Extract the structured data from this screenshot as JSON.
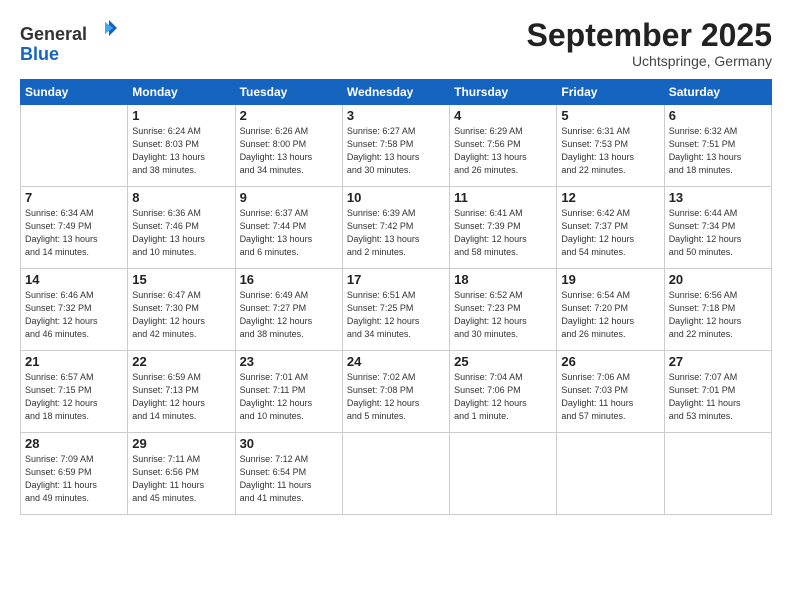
{
  "header": {
    "logo_general": "General",
    "logo_blue": "Blue",
    "title": "September 2025",
    "location": "Uchtspringe, Germany"
  },
  "weekdays": [
    "Sunday",
    "Monday",
    "Tuesday",
    "Wednesday",
    "Thursday",
    "Friday",
    "Saturday"
  ],
  "weeks": [
    [
      {
        "day": "",
        "info": ""
      },
      {
        "day": "1",
        "info": "Sunrise: 6:24 AM\nSunset: 8:03 PM\nDaylight: 13 hours\nand 38 minutes."
      },
      {
        "day": "2",
        "info": "Sunrise: 6:26 AM\nSunset: 8:00 PM\nDaylight: 13 hours\nand 34 minutes."
      },
      {
        "day": "3",
        "info": "Sunrise: 6:27 AM\nSunset: 7:58 PM\nDaylight: 13 hours\nand 30 minutes."
      },
      {
        "day": "4",
        "info": "Sunrise: 6:29 AM\nSunset: 7:56 PM\nDaylight: 13 hours\nand 26 minutes."
      },
      {
        "day": "5",
        "info": "Sunrise: 6:31 AM\nSunset: 7:53 PM\nDaylight: 13 hours\nand 22 minutes."
      },
      {
        "day": "6",
        "info": "Sunrise: 6:32 AM\nSunset: 7:51 PM\nDaylight: 13 hours\nand 18 minutes."
      }
    ],
    [
      {
        "day": "7",
        "info": "Sunrise: 6:34 AM\nSunset: 7:49 PM\nDaylight: 13 hours\nand 14 minutes."
      },
      {
        "day": "8",
        "info": "Sunrise: 6:36 AM\nSunset: 7:46 PM\nDaylight: 13 hours\nand 10 minutes."
      },
      {
        "day": "9",
        "info": "Sunrise: 6:37 AM\nSunset: 7:44 PM\nDaylight: 13 hours\nand 6 minutes."
      },
      {
        "day": "10",
        "info": "Sunrise: 6:39 AM\nSunset: 7:42 PM\nDaylight: 13 hours\nand 2 minutes."
      },
      {
        "day": "11",
        "info": "Sunrise: 6:41 AM\nSunset: 7:39 PM\nDaylight: 12 hours\nand 58 minutes."
      },
      {
        "day": "12",
        "info": "Sunrise: 6:42 AM\nSunset: 7:37 PM\nDaylight: 12 hours\nand 54 minutes."
      },
      {
        "day": "13",
        "info": "Sunrise: 6:44 AM\nSunset: 7:34 PM\nDaylight: 12 hours\nand 50 minutes."
      }
    ],
    [
      {
        "day": "14",
        "info": "Sunrise: 6:46 AM\nSunset: 7:32 PM\nDaylight: 12 hours\nand 46 minutes."
      },
      {
        "day": "15",
        "info": "Sunrise: 6:47 AM\nSunset: 7:30 PM\nDaylight: 12 hours\nand 42 minutes."
      },
      {
        "day": "16",
        "info": "Sunrise: 6:49 AM\nSunset: 7:27 PM\nDaylight: 12 hours\nand 38 minutes."
      },
      {
        "day": "17",
        "info": "Sunrise: 6:51 AM\nSunset: 7:25 PM\nDaylight: 12 hours\nand 34 minutes."
      },
      {
        "day": "18",
        "info": "Sunrise: 6:52 AM\nSunset: 7:23 PM\nDaylight: 12 hours\nand 30 minutes."
      },
      {
        "day": "19",
        "info": "Sunrise: 6:54 AM\nSunset: 7:20 PM\nDaylight: 12 hours\nand 26 minutes."
      },
      {
        "day": "20",
        "info": "Sunrise: 6:56 AM\nSunset: 7:18 PM\nDaylight: 12 hours\nand 22 minutes."
      }
    ],
    [
      {
        "day": "21",
        "info": "Sunrise: 6:57 AM\nSunset: 7:15 PM\nDaylight: 12 hours\nand 18 minutes."
      },
      {
        "day": "22",
        "info": "Sunrise: 6:59 AM\nSunset: 7:13 PM\nDaylight: 12 hours\nand 14 minutes."
      },
      {
        "day": "23",
        "info": "Sunrise: 7:01 AM\nSunset: 7:11 PM\nDaylight: 12 hours\nand 10 minutes."
      },
      {
        "day": "24",
        "info": "Sunrise: 7:02 AM\nSunset: 7:08 PM\nDaylight: 12 hours\nand 5 minutes."
      },
      {
        "day": "25",
        "info": "Sunrise: 7:04 AM\nSunset: 7:06 PM\nDaylight: 12 hours\nand 1 minute."
      },
      {
        "day": "26",
        "info": "Sunrise: 7:06 AM\nSunset: 7:03 PM\nDaylight: 11 hours\nand 57 minutes."
      },
      {
        "day": "27",
        "info": "Sunrise: 7:07 AM\nSunset: 7:01 PM\nDaylight: 11 hours\nand 53 minutes."
      }
    ],
    [
      {
        "day": "28",
        "info": "Sunrise: 7:09 AM\nSunset: 6:59 PM\nDaylight: 11 hours\nand 49 minutes."
      },
      {
        "day": "29",
        "info": "Sunrise: 7:11 AM\nSunset: 6:56 PM\nDaylight: 11 hours\nand 45 minutes."
      },
      {
        "day": "30",
        "info": "Sunrise: 7:12 AM\nSunset: 6:54 PM\nDaylight: 11 hours\nand 41 minutes."
      },
      {
        "day": "",
        "info": ""
      },
      {
        "day": "",
        "info": ""
      },
      {
        "day": "",
        "info": ""
      },
      {
        "day": "",
        "info": ""
      }
    ]
  ]
}
